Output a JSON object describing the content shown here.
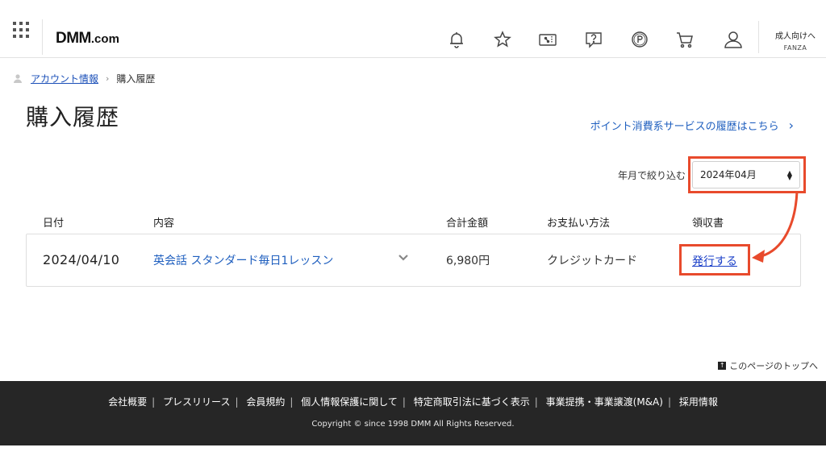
{
  "header": {
    "logo_main": "DMM",
    "logo_suffix": ".com",
    "adult_line1": "成人向けへ",
    "adult_line2": "FANZA"
  },
  "breadcrumb": {
    "parent": "アカウント情報",
    "separator": "›",
    "current": "購入履歴"
  },
  "page": {
    "title": "購入履歴",
    "points_link": "ポイント消費系サービスの履歴はこちら",
    "points_chevron": "›"
  },
  "filter": {
    "label": "年月で絞り込む",
    "selected": "2024年04月",
    "arrow_up": "▲",
    "arrow_down": "▼"
  },
  "table": {
    "headers": {
      "date": "日付",
      "content": "内容",
      "total": "合計金額",
      "payment": "お支払い方法",
      "receipt": "領収書"
    },
    "rows": [
      {
        "date": "2024/04/10",
        "item": "英会話 スタンダード毎日1レッスン",
        "price": "6,980円",
        "payment": "クレジットカード",
        "receipt_action": "発行する"
      }
    ]
  },
  "to_top": {
    "label": "このページのトップへ",
    "glyph": "↑"
  },
  "footer": {
    "links": [
      "会社概要",
      "プレスリリース",
      "会員規約",
      "個人情報保護に関して",
      "特定商取引法に基づく表示",
      "事業提携・事業譲渡(M&A)",
      "採用情報"
    ],
    "separator": "|",
    "copyright": "Copyright © since 1998 DMM All Rights Reserved."
  },
  "colors": {
    "highlight": "#e84a2c",
    "link": "#1f5fbf",
    "footer_bg": "#262626"
  },
  "icons": [
    "grid-menu-icon",
    "bell-icon",
    "star-icon",
    "coupon-icon",
    "help-icon",
    "point-icon",
    "cart-icon",
    "user-icon",
    "chevron-down-icon",
    "arrow-up-icon"
  ]
}
